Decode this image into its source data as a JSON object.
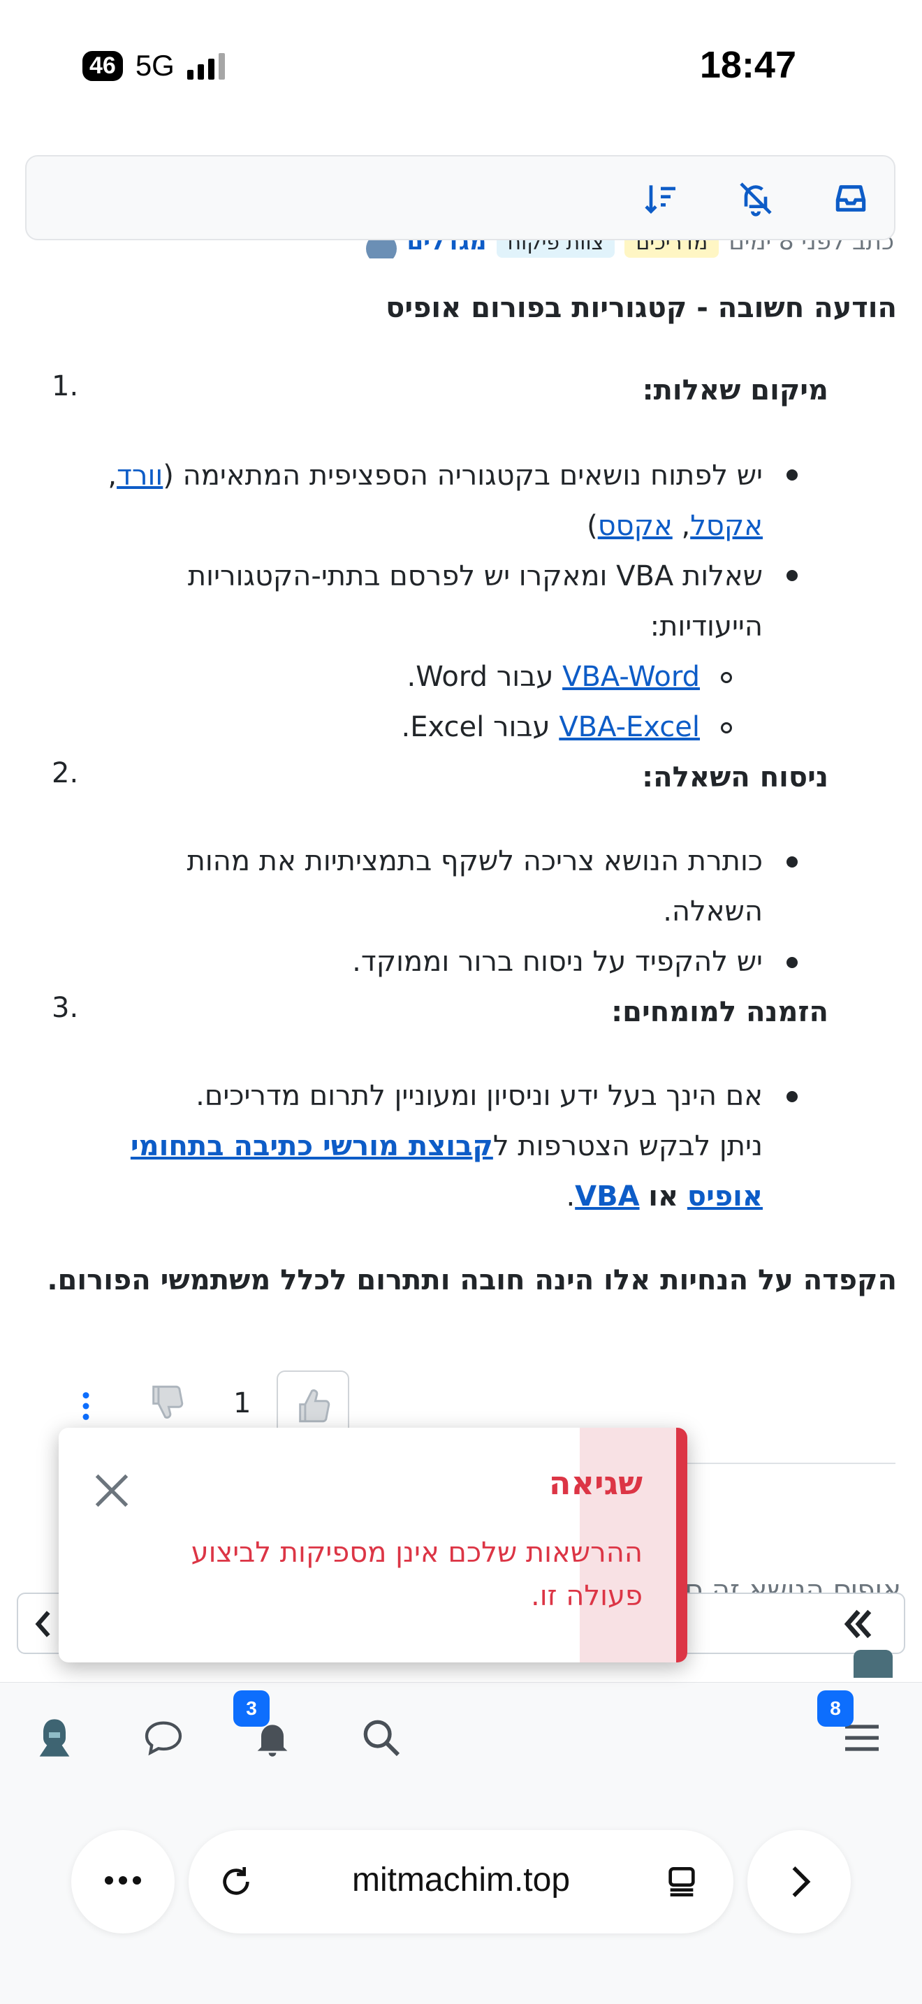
{
  "status_bar": {
    "time": "18:47",
    "battery": "46",
    "network": "5G"
  },
  "post": {
    "author": "מגדלים",
    "badges": [
      {
        "label": "צוות פיקוח",
        "color": "#e1f3fb"
      },
      {
        "label": "מדריכים",
        "color": "#fff6c4"
      }
    ],
    "meta": "כתב לפני 8 ימים",
    "heading": "הודעה חשובה - קטגוריות בפורום אופיס",
    "section1_num": "1.",
    "section1_title": "מיקום שאלות:",
    "s1_b1_text": "יש לפתוח נושאים בקטגוריה הספציפית המתאימה (",
    "s1_b1_link1": "וורד",
    "s1_b1_sep1": ",",
    "s1_b1_link2": "אקסל",
    "s1_b1_sep2": ",",
    "s1_b1_link3": "אקסס",
    "s1_b1_end": ")",
    "s1_b2_line1": "שאלות VBA ומאקרו יש לפרסם בתתי-הקטגוריות",
    "s1_b2_line2": "הייעודיות:",
    "s1_sub1_link": "VBA-Word",
    "s1_sub1_text": "עבור Word.",
    "s1_sub2_link": "VBA-Excel",
    "s1_sub2_text": "עבור Excel.",
    "section2_num": "2.",
    "section2_title": "ניסוח השאלה:",
    "s2_b1_line1": "כותרת הנושא צריכה לשקף בתמציתיות את מהות",
    "s2_b1_line2": "השאלה.",
    "s2_b2": "יש להקפיד על ניסוח ברור וממוקד.",
    "section3_num": "3.",
    "section3_title": "הזמנה למומחים:",
    "s3_b1_line1": "אם הינך בעל ידע וניסיון ומעוניין לתרום מדריכים.",
    "s3_b1_line2_text": "ניתן לבקש הצטרפות ל",
    "s3_b1_line2_link": "קבוצת מורשי כתיבה בתחומי",
    "s3_b1_line3_link1": "אופיס",
    "s3_b1_line3_mid": "או",
    "s3_b1_line3_link2": "VBA",
    "s3_b1_line3_end": ".",
    "closing": "הקפדה על הנחיות אלו הינה חובה ותתרום לכלל משתמשי הפורום.",
    "vote_count": "1",
    "reply_preview": "אופיס הנושא זה ס"
  },
  "toast": {
    "title": "שגיאה",
    "message": "ההרשאות שלכם אינן מספיקות לביצוע פעולה זו."
  },
  "bottom_nav": {
    "notifications_badge": "3",
    "menu_badge": "8"
  },
  "browser": {
    "url": "mitmachim.top"
  }
}
